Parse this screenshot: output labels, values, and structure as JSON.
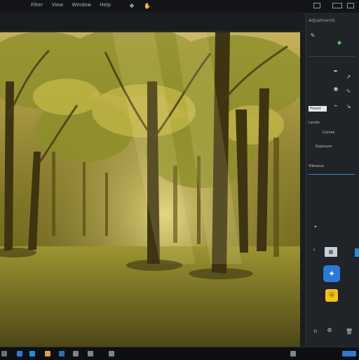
{
  "menubar": {
    "items": [
      "Filter",
      "View",
      "Window",
      "Help"
    ]
  },
  "panel": {
    "header": "Adjustments",
    "sections": [
      {
        "label": "Levels"
      },
      {
        "label": "Curves"
      },
      {
        "label": "Exposure"
      },
      {
        "label": "Vibrance"
      }
    ],
    "button_label": "Preset"
  },
  "canvas": {
    "scene": "forest",
    "accent_color": "#d8c12b"
  },
  "taskbar": {
    "items": [
      "start",
      "search",
      "task-view",
      "explorer",
      "photoshop"
    ]
  },
  "colors": {
    "chrome": "#121417",
    "panel": "#202328",
    "accent_blue": "#2b7ad8"
  }
}
